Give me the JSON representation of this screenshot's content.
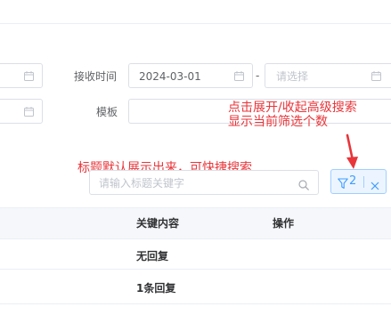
{
  "filters": {
    "receive_time_label": "接收时间",
    "date_start_value": "2024-03-01",
    "date_range_separator": "-",
    "date_end_placeholder": "请选择",
    "template_label": "模板"
  },
  "search": {
    "placeholder": "请输入标题关键字",
    "filter_count": "2"
  },
  "annotations": {
    "toggle_hint_line1": "点击展开/收起高级搜索",
    "toggle_hint_line2": "显示当前筛选个数",
    "title_hint": "标题默认展示出来，可快捷搜索"
  },
  "table": {
    "columns": [
      "关键内容",
      "操作"
    ],
    "rows": [
      {
        "key_content": "无回复"
      },
      {
        "key_content": "1条回复"
      }
    ]
  },
  "colors": {
    "annotation": "#e8353a",
    "accent": "#409eff",
    "border": "#dcdfe6"
  },
  "icons": [
    "calendar-icon",
    "search-icon",
    "filter-icon",
    "close-icon",
    "arrow-icon"
  ]
}
